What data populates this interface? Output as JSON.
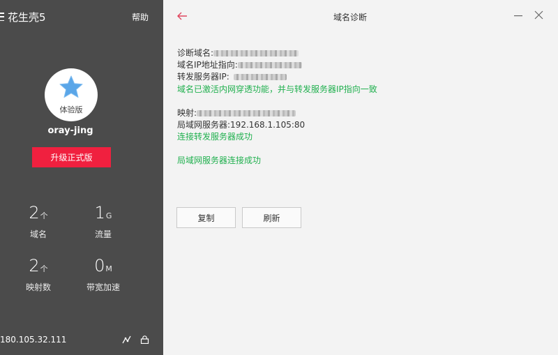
{
  "app": {
    "title": "花生壳5",
    "help_label": "帮助"
  },
  "profile": {
    "edition": "体验版",
    "username": "oray-jing",
    "upgrade_label": "升级正式版"
  },
  "stats": [
    {
      "value": "2",
      "unit": "个",
      "label": "域名"
    },
    {
      "value": "1",
      "unit": "G",
      "label": "流量"
    },
    {
      "value": "2",
      "unit": "个",
      "label": "映射数"
    },
    {
      "value": "0",
      "unit": "M",
      "label": "带宽加速"
    }
  ],
  "footer": {
    "ip": "180.105.32.111"
  },
  "panel": {
    "title": "域名诊断",
    "diag_domain_label": "诊断域名:",
    "domain_ip_label": "域名IP地址指向:",
    "forward_ip_label": "转发服务器IP:",
    "penetration_status": "域名已激活内网穿透功能，并与转发服务器IP指向一致",
    "mapping_label": "映射:",
    "lan_server_label": "局域网服务器:",
    "lan_server_value": "192.168.1.105:80",
    "forward_connect_status": "连接转发服务器成功",
    "lan_connect_status": "局域网服务器连接成功",
    "copy_label": "复制",
    "refresh_label": "刷新"
  },
  "colors": {
    "sidebar_bg": "#4b4b4b",
    "accent_red": "#f0203f",
    "success_green": "#21b04f",
    "star_blue": "#5aa6e8",
    "back_arrow": "#e0455e"
  }
}
